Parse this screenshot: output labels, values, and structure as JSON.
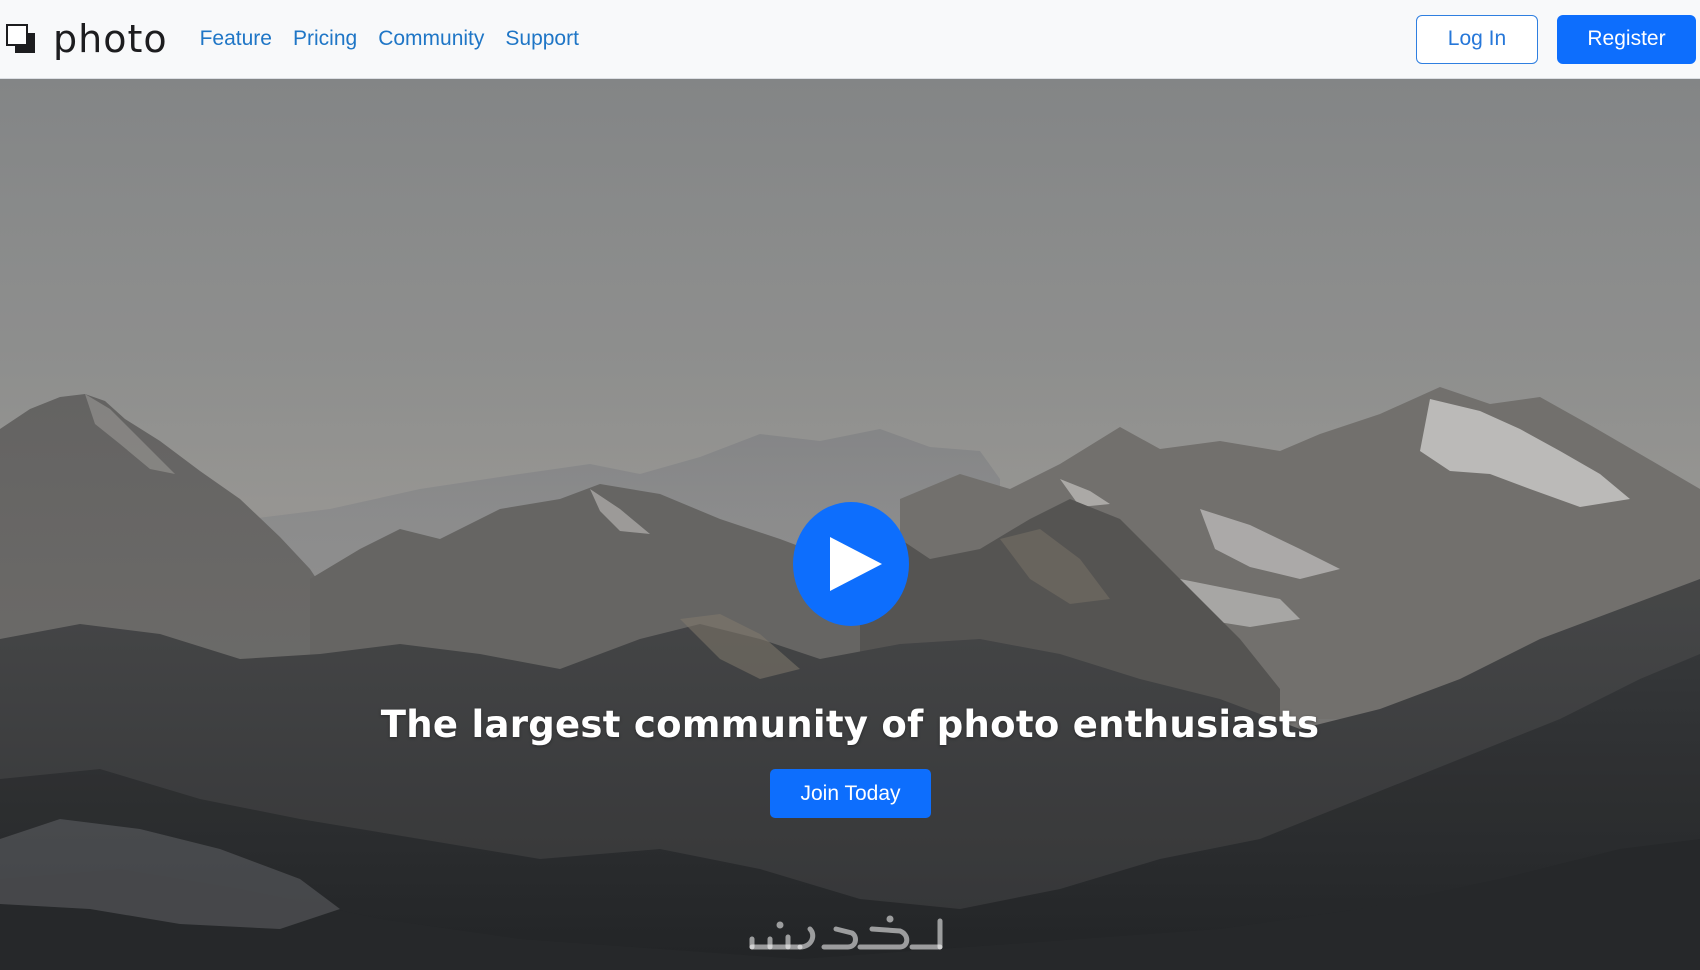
{
  "navbar": {
    "brand": {
      "icon": "square-stack-logo-icon",
      "name": "photo"
    },
    "links": [
      {
        "label": "Feature"
      },
      {
        "label": "Pricing"
      },
      {
        "label": "Community"
      },
      {
        "label": "Support"
      }
    ],
    "login_label": "Log In",
    "register_label": "Register"
  },
  "hero": {
    "background": "mountain-landscape-photo",
    "play_icon": "play-icon",
    "title": "The largest community of photo enthusiasts",
    "cta_label": "Join Today",
    "watermark": "khamsat-logo"
  },
  "colors": {
    "primary": "#0d6efd",
    "link": "#1f76c6",
    "navbar_bg": "#f8f9fa"
  }
}
